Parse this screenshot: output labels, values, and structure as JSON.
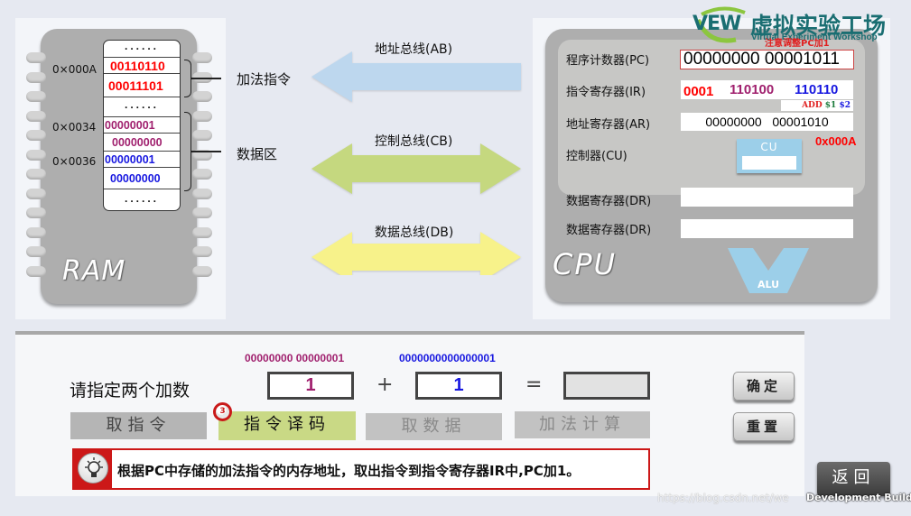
{
  "ram": {
    "label": "RAM",
    "addresses": [
      "0×000A",
      "0×0034",
      "0×0036"
    ],
    "rows": [
      {
        "type": "dots",
        "text": "......"
      },
      {
        "type": "value",
        "text": "00110110",
        "color": "#ff0000"
      },
      {
        "type": "value",
        "text": "00011101",
        "color": "#ff0000"
      },
      {
        "type": "dots",
        "text": "......"
      },
      {
        "type": "value",
        "text": "00000001",
        "color": "#a0206e"
      },
      {
        "type": "value",
        "text": "00000000",
        "color": "#a0206e"
      },
      {
        "type": "value",
        "text": "00000001",
        "color": "#1818e0"
      },
      {
        "type": "value",
        "text": "00000000",
        "color": "#1818e0"
      },
      {
        "type": "dots",
        "text": "......"
      }
    ],
    "group_labels": [
      "加法指令",
      "数据区"
    ]
  },
  "buses": [
    {
      "label": "地址总线(AB)",
      "color": "#bdd7ee",
      "direction": "left"
    },
    {
      "label": "控制总线(CB)",
      "color": "#c5d87f",
      "direction": "both"
    },
    {
      "label": "数据总线(DB)",
      "color": "#f7f28a",
      "direction": "both"
    }
  ],
  "logo": {
    "mark": "VEW",
    "title": "虚拟实验工场",
    "subtitle": "Virtual Experiment Workshop",
    "overlay_note": "注意调整PC加1"
  },
  "cpu": {
    "label": "CPU",
    "pc": {
      "label": "程序计数器(PC)",
      "value": "00000000 00001011"
    },
    "ir": {
      "label": "指令寄存器(IR)",
      "opcode": "0001",
      "op1": "110100",
      "op2": "110110",
      "decode": {
        "op": "ADD",
        "r1": "$1",
        "r2": "$2"
      }
    },
    "ar": {
      "label": "地址寄存器(AR)",
      "value": "00000000   00001010"
    },
    "cu": {
      "label": "控制器(CU)",
      "box_label": "CU",
      "address": "0x000A"
    },
    "dr1": {
      "label": "数据寄存器(DR)",
      "value": ""
    },
    "dr2": {
      "label": "数据寄存器(DR)",
      "value": ""
    },
    "alu": {
      "label": "ALU"
    }
  },
  "controls": {
    "prompt": "请指定两个加数",
    "operand1": {
      "binary": "00000000 00000001",
      "value": "1",
      "color": "#a0206e"
    },
    "operand2": {
      "binary": "0000000000000001",
      "value": "1",
      "color": "#1818e0"
    },
    "plus": "+",
    "equals": "=",
    "result": "",
    "steps": [
      {
        "label": "取指令",
        "state": "done"
      },
      {
        "label": "指令译码",
        "state": "active",
        "badge": "3"
      },
      {
        "label": "取数据",
        "state": "disabled"
      },
      {
        "label": "加法计算",
        "state": "disabled"
      }
    ],
    "confirm_label": "确定",
    "reset_label": "重置",
    "hint": "根据PC中存储的加法指令的内存地址，取出指令到指令寄存器IR中,PC加1。"
  },
  "back_label": "返回",
  "watermark": "https://blog.csdn.net/we",
  "dev_build": "Development Build"
}
